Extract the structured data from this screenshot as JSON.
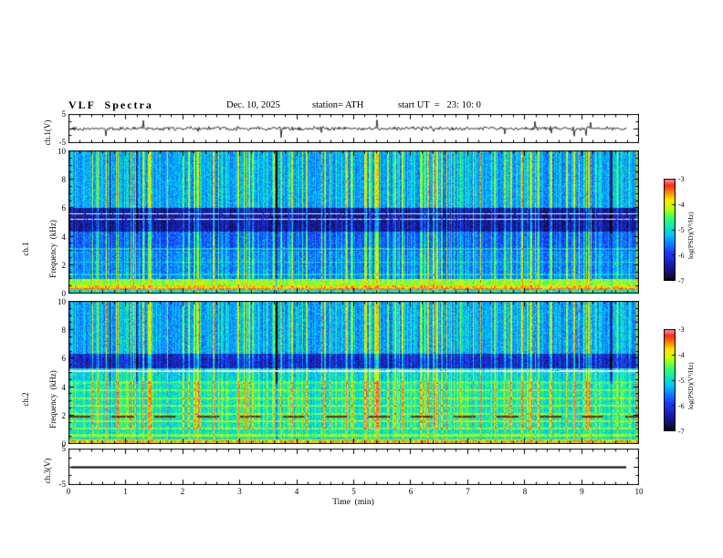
{
  "header": {
    "title": "VLF  Spectra",
    "date": "Dec. 10, 2025",
    "station": "station= ATH",
    "start_ut": "start UT  =   23: 10: 0"
  },
  "axes": {
    "x_label": "Time  (min)",
    "x_ticks": [
      "0",
      "1",
      "2",
      "3",
      "4",
      "5",
      "6",
      "7",
      "8",
      "9",
      "10"
    ]
  },
  "panels": {
    "ch1_wave": {
      "label": "ch.1(V)",
      "y_top": "5",
      "y_bottom": "-5"
    },
    "ch1_spec": {
      "label_line1": "ch.1",
      "label_line2": "Frequency  (kHz)",
      "y_ticks": [
        "0",
        "2",
        "4",
        "6",
        "8",
        "10"
      ]
    },
    "ch2_spec": {
      "label_line1": "ch.2",
      "label_line2": "Frequency  (kHz)",
      "y_ticks": [
        "0",
        "2",
        "4",
        "6",
        "8",
        "10"
      ]
    },
    "ch3_wave": {
      "label": "ch.3(V)",
      "y_top": "5",
      "y_bottom": "-5"
    }
  },
  "colorbar": {
    "label": "log(PSD)(V²/Hz)",
    "ticks": [
      "-3",
      "-4",
      "-5",
      "-6",
      "-7"
    ]
  },
  "colormap": [
    {
      "t": 0.0,
      "color": "#0a0a0a"
    },
    {
      "t": 0.1,
      "color": "#141482"
    },
    {
      "t": 0.28,
      "color": "#1e3cff"
    },
    {
      "t": 0.45,
      "color": "#00c8ff"
    },
    {
      "t": 0.6,
      "color": "#28ff78"
    },
    {
      "t": 0.72,
      "color": "#c8ff00"
    },
    {
      "t": 0.8,
      "color": "#ffe600"
    },
    {
      "t": 0.88,
      "color": "#ff7800"
    },
    {
      "t": 0.94,
      "color": "#ff2828"
    },
    {
      "t": 1.0,
      "color": "#ffa0aa"
    }
  ],
  "chart_data": [
    {
      "type": "line",
      "name": "ch1_voltage_waveform",
      "ylabel": "ch.1(V)",
      "ylim": [
        -5,
        5
      ],
      "xlim": [
        0,
        10
      ],
      "xlabel": "Time (min)",
      "line_color": "#000000",
      "data_end_min": 9.78,
      "description": "Noisy voltage trace centered on 0 V (about ±1 V background) with impulsive sferic spikes up to roughly ±4 V throughout the record."
    },
    {
      "type": "heatmap",
      "name": "ch1_spectrogram",
      "ylabel": "ch.1 Frequency (kHz)",
      "ylim": [
        0,
        10
      ],
      "xlim": [
        0,
        10
      ],
      "zlabel": "log(PSD)(V²/Hz)",
      "zlim": [
        -7,
        -3
      ],
      "bands": [
        {
          "f": [
            6.0,
            10.0
          ],
          "level": -5.45
        },
        {
          "f": [
            4.3,
            6.0
          ],
          "level": -6.55
        },
        {
          "f": [
            3.0,
            4.3
          ],
          "level": -5.85
        },
        {
          "f": [
            1.0,
            3.0
          ],
          "level": -5.6
        },
        {
          "f": [
            0.25,
            1.0
          ],
          "level": -4.35
        },
        {
          "f": [
            0.0,
            0.25
          ],
          "level": -5.0
        }
      ],
      "h_lines": [
        {
          "f": 0.5,
          "w": 0.1,
          "level": -3.9
        },
        {
          "f": 0.32,
          "w": 0.05,
          "level": -3.5
        },
        {
          "f": 1.35,
          "w": 0.05,
          "level": -5.2
        },
        {
          "f": 2.2,
          "w": 0.06,
          "level": -5.15
        },
        {
          "f": 3.1,
          "w": 0.06,
          "level": -5.3
        }
      ],
      "white_rows": [
        5.2,
        5.55
      ],
      "description": "Blue background with dense vertical sferic streaks (cyan-green), dark attenuation band ~4.3-6 kHz with thin white horizontal lines, bright green-yellow band below 1 kHz, occasional black dropout columns."
    },
    {
      "type": "heatmap",
      "name": "ch2_spectrogram",
      "ylabel": "ch.2 Frequency (kHz)",
      "ylim": [
        0,
        10
      ],
      "xlim": [
        0,
        10
      ],
      "zlabel": "log(PSD)(V²/Hz)",
      "zlim": [
        -7,
        -3
      ],
      "bands": [
        {
          "f": [
            6.3,
            10.0
          ],
          "level": -5.45
        },
        {
          "f": [
            5.3,
            6.3
          ],
          "level": -6.3
        },
        {
          "f": [
            4.3,
            5.3
          ],
          "level": -5.15
        },
        {
          "f": [
            0.35,
            4.3
          ],
          "level": -5.0
        },
        {
          "f": [
            0.0,
            0.35
          ],
          "level": -4.1
        }
      ],
      "h_lines": [
        {
          "f": 0.2,
          "w": 0.06,
          "level": -3.7
        },
        {
          "f": 0.6,
          "w": 0.07,
          "level": -4.35
        },
        {
          "f": 1.1,
          "w": 0.07,
          "level": -4.4
        },
        {
          "f": 1.6,
          "w": 0.07,
          "level": -4.35
        },
        {
          "f": 2.1,
          "w": 0.07,
          "level": -4.45
        },
        {
          "f": 2.65,
          "w": 0.07,
          "level": -4.4
        },
        {
          "f": 3.2,
          "w": 0.07,
          "level": -4.45
        },
        {
          "f": 3.75,
          "w": 0.07,
          "level": -4.5
        },
        {
          "f": 4.3,
          "w": 0.07,
          "level": -4.7
        }
      ],
      "white_rows": [
        5.1
      ],
      "dashes": {
        "f": 1.92,
        "w": 0.07,
        "period_min": 0.75,
        "duty": 0.5,
        "color": "#7a2a00"
      },
      "description": "Cyan background crossed by the same sferic streaks; darker band ~5.3-6.3 kHz; many narrow yellow-green horizontal harmonic lines below ~4.5 kHz; dark-red dashed segments near 1.9 kHz; bright yellow band at the very bottom."
    },
    {
      "type": "line",
      "name": "ch3_voltage_waveform",
      "ylabel": "ch.3(V)",
      "ylim": [
        -5,
        5
      ],
      "xlim": [
        0,
        10
      ],
      "line_color": "#000000",
      "data_end_min": 9.78,
      "constant_value": 0,
      "description": "Flat heavy black line at 0 V (no signal on channel 3)."
    }
  ]
}
